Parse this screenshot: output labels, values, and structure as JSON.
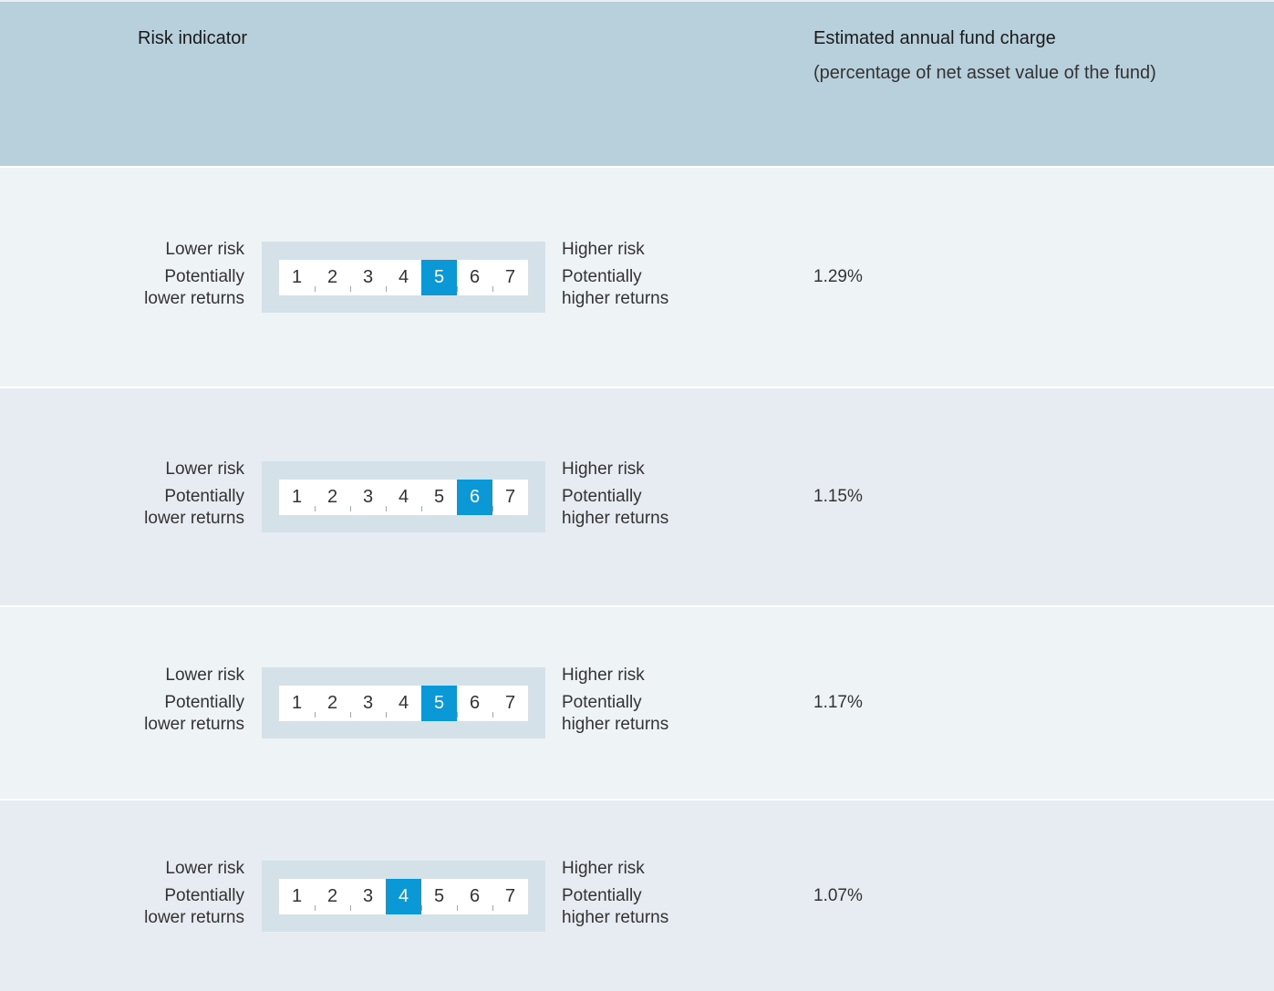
{
  "header": {
    "risk_title": "Risk indicator",
    "charge_title": "Estimated annual fund charge",
    "charge_subtitle": "(percentage of net asset value of the fund)"
  },
  "labels": {
    "lower_risk": "Lower risk",
    "lower_returns_1": "Potentially",
    "lower_returns_2": "lower returns",
    "higher_risk": "Higher risk",
    "higher_returns_1": "Potentially",
    "higher_returns_2": "higher returns"
  },
  "scale_numbers": [
    "1",
    "2",
    "3",
    "4",
    "5",
    "6",
    "7"
  ],
  "rows": [
    {
      "risk_level": 5,
      "charge": "1.29%"
    },
    {
      "risk_level": 6,
      "charge": "1.15%"
    },
    {
      "risk_level": 5,
      "charge": "1.17%"
    },
    {
      "risk_level": 4,
      "charge": "1.07%"
    }
  ],
  "colors": {
    "header_bg": "#b8d0dc",
    "active_cell": "#0a99d6",
    "scale_frame": "#d4e1e9"
  }
}
